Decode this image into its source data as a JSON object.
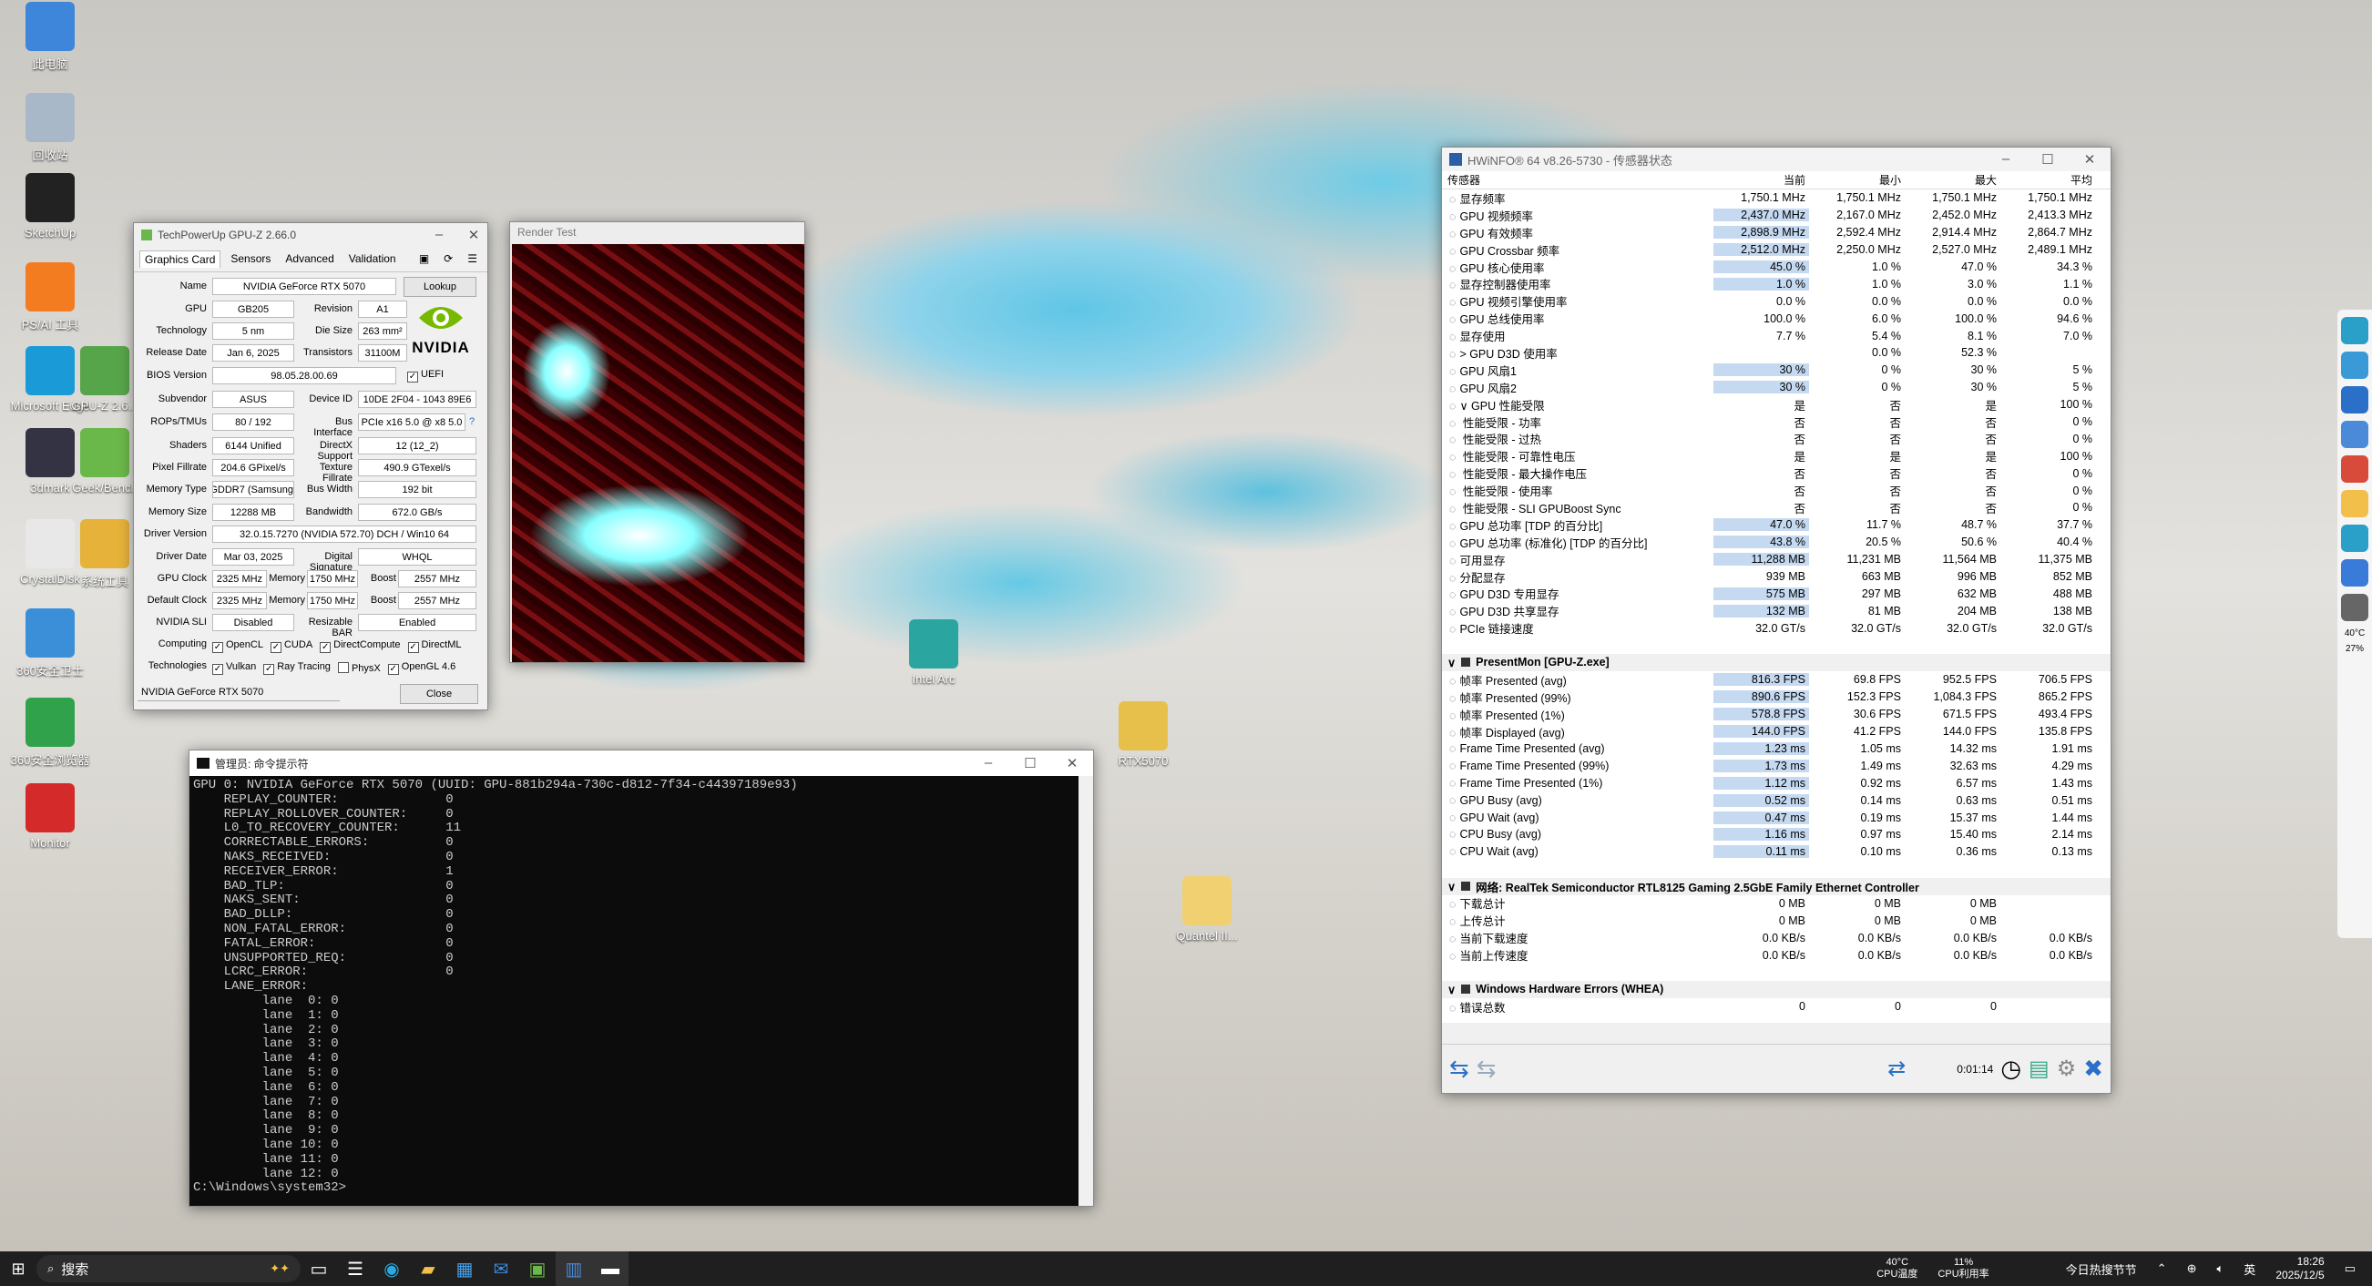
{
  "desktop": {
    "icons": [
      {
        "label": "此电脑",
        "color": "#3d86d9"
      },
      {
        "label": "回收站",
        "color": "#a8b8c8"
      },
      {
        "label": "SketchUp",
        "color": "#222"
      },
      {
        "label": "PS/AI 工具",
        "color": "#f47c20"
      },
      {
        "label": "Microsoft Edge",
        "color": "#1a9ad6"
      },
      {
        "label": "GPU-Z 2.6...",
        "color": "#57a54a"
      },
      {
        "label": "3dmark",
        "color": "#334"
      },
      {
        "label": "Geek/Bench",
        "color": "#6bb84a"
      },
      {
        "label": "CrystalDisk",
        "color": "#e8e8e8"
      },
      {
        "label": "系统工具",
        "color": "#e6b23a"
      },
      {
        "label": "360安全卫士",
        "color": "#3a8fd8"
      },
      {
        "label": "360安全浏览器",
        "color": "#31a24c"
      },
      {
        "label": "Monitor",
        "color": "#d52a2a"
      },
      {
        "label": "Intel Arc",
        "color": "#2aa5a0"
      },
      {
        "label": "RTX5070",
        "color": "#e7c04c"
      },
      {
        "label": "Quantel II...",
        "color": "#f0d070"
      }
    ]
  },
  "gpuz": {
    "title": "TechPowerUp GPU-Z 2.66.0",
    "tabs": [
      "Graphics Card",
      "Sensors",
      "Advanced",
      "Validation"
    ],
    "name_label": "Name",
    "name": "NVIDIA GeForce RTX 5070",
    "lookup": "Lookup",
    "gpu_label": "GPU",
    "gpu": "GB205",
    "rev_label": "Revision",
    "rev": "A1",
    "tech_label": "Technology",
    "tech": "5 nm",
    "die_label": "Die Size",
    "die": "263 mm²",
    "rel_label": "Release Date",
    "rel": "Jan 6, 2025",
    "trans_label": "Transistors",
    "trans": "31100M",
    "bios_label": "BIOS Version",
    "bios": "98.05.28.00.69",
    "uefi": "UEFI",
    "subv_label": "Subvendor",
    "subv": "ASUS",
    "devid_label": "Device ID",
    "devid": "10DE 2F04 - 1043 89E6",
    "rops_label": "ROPs/TMUs",
    "rops": "80 / 192",
    "bus_label": "Bus Interface",
    "bus": "PCIe x16 5.0 @ x8 5.0",
    "bus_q": "?",
    "shaders_label": "Shaders",
    "shaders": "6144 Unified",
    "dx_label": "DirectX Support",
    "dx": "12 (12_2)",
    "pix_label": "Pixel Fillrate",
    "pix": "204.6 GPixel/s",
    "tex_label": "Texture Fillrate",
    "tex": "490.9 GTexel/s",
    "memtype_label": "Memory Type",
    "memtype": "GDDR7 (Samsung)",
    "bw_label": "Bus Width",
    "bw": "192 bit",
    "memsize_label": "Memory Size",
    "memsize": "12288 MB",
    "band_label": "Bandwidth",
    "band": "672.0 GB/s",
    "drv_label": "Driver Version",
    "drv": "32.0.15.7270 (NVIDIA 572.70) DCH / Win10 64",
    "drvdate_label": "Driver Date",
    "drvdate": "Mar 03, 2025",
    "sig_label": "Digital Signature",
    "sig": "WHQL",
    "gclk_label": "GPU Clock",
    "gclk": "2325 MHz",
    "mem_label": "Memory",
    "gmem": "1750 MHz",
    "boost_label": "Boost",
    "gboost": "2557 MHz",
    "dclk_label": "Default Clock",
    "dclk": "2325 MHz",
    "dmem": "1750 MHz",
    "dboost": "2557 MHz",
    "sli_label": "NVIDIA SLI",
    "sli": "Disabled",
    "rbar_label": "Resizable BAR",
    "rbar": "Enabled",
    "comp_label": "Computing",
    "comp": [
      "OpenCL",
      "CUDA",
      "DirectCompute",
      "DirectML"
    ],
    "techs_label": "Technologies",
    "techs": [
      "Vulkan",
      "Ray Tracing",
      "PhysX",
      "OpenGL 4.6"
    ],
    "techs_checked": [
      true,
      true,
      false,
      true
    ],
    "select": "NVIDIA GeForce RTX 5070",
    "close": "Close",
    "logo": "NVIDIA"
  },
  "render": {
    "title": "Render Test"
  },
  "cmd": {
    "title": "管理员: 命令提示符",
    "lines": [
      "GPU 0: NVIDIA GeForce RTX 5070 (UUID: GPU-881b294a-730c-d812-7f34-c44397189e93)",
      "    REPLAY_COUNTER:              0",
      "    REPLAY_ROLLOVER_COUNTER:     0",
      "    L0_TO_RECOVERY_COUNTER:      11",
      "    CORRECTABLE_ERRORS:          0",
      "    NAKS_RECEIVED:               0",
      "    RECEIVER_ERROR:              1",
      "    BAD_TLP:                     0",
      "    NAKS_SENT:                   0",
      "    BAD_DLLP:                    0",
      "    NON_FATAL_ERROR:             0",
      "    FATAL_ERROR:                 0",
      "    UNSUPPORTED_REQ:             0",
      "    LCRC_ERROR:                  0",
      "    LANE_ERROR:",
      "         lane  0: 0",
      "         lane  1: 0",
      "         lane  2: 0",
      "         lane  3: 0",
      "         lane  4: 0",
      "         lane  5: 0",
      "         lane  6: 0",
      "         lane  7: 0",
      "         lane  8: 0",
      "         lane  9: 0",
      "         lane 10: 0",
      "         lane 11: 0",
      "         lane 12: 0",
      "",
      "C:\\Windows\\system32>"
    ]
  },
  "hwinfo": {
    "title": "HWiNFO® 64 v8.26-5730 - 传感器状态",
    "cols": [
      "传感器",
      "当前",
      "最小",
      "最大",
      "平均"
    ],
    "rows": [
      {
        "t": "r",
        "n": "显存频率",
        "v": [
          "1,750.1 MHz",
          "1,750.1 MHz",
          "1,750.1 MHz",
          "1,750.1 MHz"
        ],
        "h": false
      },
      {
        "t": "r",
        "n": "GPU 视频频率",
        "v": [
          "2,437.0 MHz",
          "2,167.0 MHz",
          "2,452.0 MHz",
          "2,413.3 MHz"
        ],
        "h": true
      },
      {
        "t": "r",
        "n": "GPU 有效频率",
        "v": [
          "2,898.9 MHz",
          "2,592.4 MHz",
          "2,914.4 MHz",
          "2,864.7 MHz"
        ],
        "h": true
      },
      {
        "t": "r",
        "n": "GPU Crossbar 频率",
        "v": [
          "2,512.0 MHz",
          "2,250.0 MHz",
          "2,527.0 MHz",
          "2,489.1 MHz"
        ],
        "h": true
      },
      {
        "t": "r",
        "n": "GPU 核心使用率",
        "v": [
          "45.0 %",
          "1.0 %",
          "47.0 %",
          "34.3 %"
        ],
        "h": true
      },
      {
        "t": "r",
        "n": "显存控制器使用率",
        "v": [
          "1.0 %",
          "1.0 %",
          "3.0 %",
          "1.1 %"
        ],
        "h": true
      },
      {
        "t": "r",
        "n": "GPU 视频引擎使用率",
        "v": [
          "0.0 %",
          "0.0 %",
          "0.0 %",
          "0.0 %"
        ],
        "h": false
      },
      {
        "t": "r",
        "n": "GPU 总线使用率",
        "v": [
          "100.0 %",
          "6.0 %",
          "100.0 %",
          "94.6 %"
        ],
        "h": false
      },
      {
        "t": "r",
        "n": "显存使用",
        "v": [
          "7.7 %",
          "5.4 %",
          "8.1 %",
          "7.0 %"
        ],
        "h": false
      },
      {
        "t": "r",
        "n": "> GPU D3D 使用率",
        "v": [
          "",
          "0.0 %",
          "52.3 %",
          ""
        ],
        "h": false
      },
      {
        "t": "r",
        "n": "GPU 风扇1",
        "v": [
          "30 %",
          "0 %",
          "30 %",
          "5 %"
        ],
        "h": true
      },
      {
        "t": "r",
        "n": "GPU 风扇2",
        "v": [
          "30 %",
          "0 %",
          "30 %",
          "5 %"
        ],
        "h": true
      },
      {
        "t": "r",
        "n": "∨ GPU 性能受限",
        "v": [
          "是",
          "否",
          "是",
          "100 %"
        ],
        "h": false
      },
      {
        "t": "r",
        "n": "  性能受限 - 功率",
        "v": [
          "否",
          "否",
          "否",
          "0 %"
        ],
        "h": false
      },
      {
        "t": "r",
        "n": "  性能受限 - 过热",
        "v": [
          "否",
          "否",
          "否",
          "0 %"
        ],
        "h": false
      },
      {
        "t": "r",
        "n": "  性能受限 - 可靠性电压",
        "v": [
          "是",
          "是",
          "是",
          "100 %"
        ],
        "h": false
      },
      {
        "t": "r",
        "n": "  性能受限 - 最大操作电压",
        "v": [
          "否",
          "否",
          "否",
          "0 %"
        ],
        "h": false
      },
      {
        "t": "r",
        "n": "  性能受限 - 使用率",
        "v": [
          "否",
          "否",
          "否",
          "0 %"
        ],
        "h": false
      },
      {
        "t": "r",
        "n": "  性能受限 - SLI GPUBoost Sync",
        "v": [
          "否",
          "否",
          "否",
          "0 %"
        ],
        "h": false
      },
      {
        "t": "r",
        "n": "GPU 总功率 [TDP 的百分比]",
        "v": [
          "47.0 %",
          "11.7 %",
          "48.7 %",
          "37.7 %"
        ],
        "h": true
      },
      {
        "t": "r",
        "n": "GPU 总功率 (标准化) [TDP 的百分比]",
        "v": [
          "43.8 %",
          "20.5 %",
          "50.6 %",
          "40.4 %"
        ],
        "h": true
      },
      {
        "t": "r",
        "n": "可用显存",
        "v": [
          "11,288 MB",
          "11,231 MB",
          "11,564 MB",
          "11,375 MB"
        ],
        "h": true
      },
      {
        "t": "r",
        "n": "分配显存",
        "v": [
          "939 MB",
          "663 MB",
          "996 MB",
          "852 MB"
        ],
        "h": false
      },
      {
        "t": "r",
        "n": "GPU D3D 专用显存",
        "v": [
          "575 MB",
          "297 MB",
          "632 MB",
          "488 MB"
        ],
        "h": true
      },
      {
        "t": "r",
        "n": "GPU D3D 共享显存",
        "v": [
          "132 MB",
          "81 MB",
          "204 MB",
          "138 MB"
        ],
        "h": true
      },
      {
        "t": "r",
        "n": "PCIe 链接速度",
        "v": [
          "32.0 GT/s",
          "32.0 GT/s",
          "32.0 GT/s",
          "32.0 GT/s"
        ],
        "h": false
      },
      {
        "t": "gap"
      },
      {
        "t": "s",
        "n": "PresentMon [GPU-Z.exe]"
      },
      {
        "t": "r",
        "n": "帧率 Presented (avg)",
        "v": [
          "816.3 FPS",
          "69.8 FPS",
          "952.5 FPS",
          "706.5 FPS"
        ],
        "h": true
      },
      {
        "t": "r",
        "n": "帧率 Presented (99%)",
        "v": [
          "890.6 FPS",
          "152.3 FPS",
          "1,084.3 FPS",
          "865.2 FPS"
        ],
        "h": true
      },
      {
        "t": "r",
        "n": "帧率 Presented (1%)",
        "v": [
          "578.8 FPS",
          "30.6 FPS",
          "671.5 FPS",
          "493.4 FPS"
        ],
        "h": true
      },
      {
        "t": "r",
        "n": "帧率 Displayed (avg)",
        "v": [
          "144.0 FPS",
          "41.2 FPS",
          "144.0 FPS",
          "135.8 FPS"
        ],
        "h": true
      },
      {
        "t": "r",
        "n": "Frame Time Presented (avg)",
        "v": [
          "1.23 ms",
          "1.05 ms",
          "14.32 ms",
          "1.91 ms"
        ],
        "h": true
      },
      {
        "t": "r",
        "n": "Frame Time Presented (99%)",
        "v": [
          "1.73 ms",
          "1.49 ms",
          "32.63 ms",
          "4.29 ms"
        ],
        "h": true
      },
      {
        "t": "r",
        "n": "Frame Time Presented (1%)",
        "v": [
          "1.12 ms",
          "0.92 ms",
          "6.57 ms",
          "1.43 ms"
        ],
        "h": true
      },
      {
        "t": "r",
        "n": "GPU Busy (avg)",
        "v": [
          "0.52 ms",
          "0.14 ms",
          "0.63 ms",
          "0.51 ms"
        ],
        "h": true
      },
      {
        "t": "r",
        "n": "GPU Wait (avg)",
        "v": [
          "0.47 ms",
          "0.19 ms",
          "15.37 ms",
          "1.44 ms"
        ],
        "h": true
      },
      {
        "t": "r",
        "n": "CPU Busy (avg)",
        "v": [
          "1.16 ms",
          "0.97 ms",
          "15.40 ms",
          "2.14 ms"
        ],
        "h": true
      },
      {
        "t": "r",
        "n": "CPU Wait (avg)",
        "v": [
          "0.11 ms",
          "0.10 ms",
          "0.36 ms",
          "0.13 ms"
        ],
        "h": true
      },
      {
        "t": "gap"
      },
      {
        "t": "s",
        "n": "网络: RealTek Semiconductor RTL8125 Gaming 2.5GbE Family Ethernet Controller"
      },
      {
        "t": "r",
        "n": "下载总计",
        "v": [
          "0 MB",
          "0 MB",
          "0 MB",
          ""
        ],
        "h": false
      },
      {
        "t": "r",
        "n": "上传总计",
        "v": [
          "0 MB",
          "0 MB",
          "0 MB",
          ""
        ],
        "h": false
      },
      {
        "t": "r",
        "n": "当前下载速度",
        "v": [
          "0.0 KB/s",
          "0.0 KB/s",
          "0.0 KB/s",
          "0.0 KB/s"
        ],
        "h": false
      },
      {
        "t": "r",
        "n": "当前上传速度",
        "v": [
          "0.0 KB/s",
          "0.0 KB/s",
          "0.0 KB/s",
          "0.0 KB/s"
        ],
        "h": false
      },
      {
        "t": "gap"
      },
      {
        "t": "s",
        "n": "Windows Hardware Errors (WHEA)"
      },
      {
        "t": "r",
        "n": "错误总数",
        "v": [
          "0",
          "0",
          "0",
          ""
        ],
        "h": false
      }
    ],
    "timer": "0:01:14"
  },
  "taskbar": {
    "search": "搜索",
    "cpu_temp": "40°C",
    "cpu_temp_label": "CPU温度",
    "cpu_use": "11%",
    "cpu_use_label": "CPU利用率",
    "news": "今日热搜节节",
    "ime": "英",
    "time": "18:26",
    "date": "2025/12/5"
  },
  "sidebar": {
    "temps": [
      "40°C",
      "27%"
    ]
  }
}
